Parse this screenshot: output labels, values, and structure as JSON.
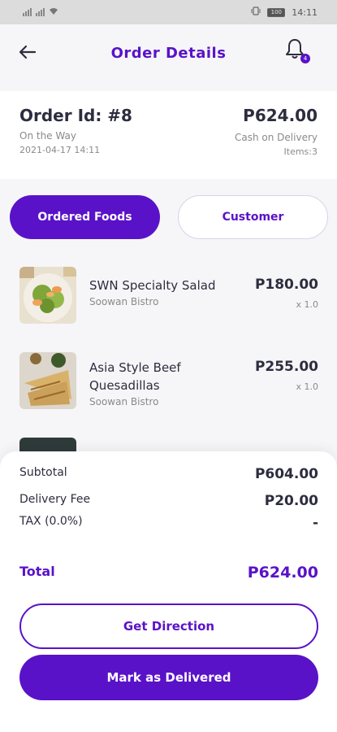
{
  "status_bar": {
    "time": "14:11",
    "battery": "100"
  },
  "header": {
    "title": "Order Details",
    "notification_count": "4"
  },
  "order": {
    "id_label": "Order Id: #8",
    "total": "P624.00",
    "status": "On the Way",
    "date": "2021-04-17 14:11",
    "payment": "Cash on Delivery",
    "items": "Items:3"
  },
  "tabs": {
    "foods": "Ordered Foods",
    "customer": "Customer"
  },
  "foods": [
    {
      "name": "SWN Specialty Salad",
      "vendor": "Soowan Bistro",
      "price": "P180.00",
      "qty": "x 1.0"
    },
    {
      "name": "Asia Style Beef Quesadillas",
      "vendor": "Soowan Bistro",
      "price": "P255.00",
      "qty": "x 1.0"
    }
  ],
  "summary": {
    "subtotal_label": "Subtotal",
    "subtotal": "P604.00",
    "delivery_label": "Delivery Fee",
    "delivery": "P20.00",
    "tax_label": "TAX (0.0%)",
    "tax": "-",
    "total_label": "Total",
    "total": "P624.00"
  },
  "actions": {
    "direction": "Get Direction",
    "delivered": "Mark as Delivered"
  },
  "colors": {
    "accent": "#5a12c8",
    "text": "#2d2d3f",
    "muted": "#8a8a8a"
  }
}
